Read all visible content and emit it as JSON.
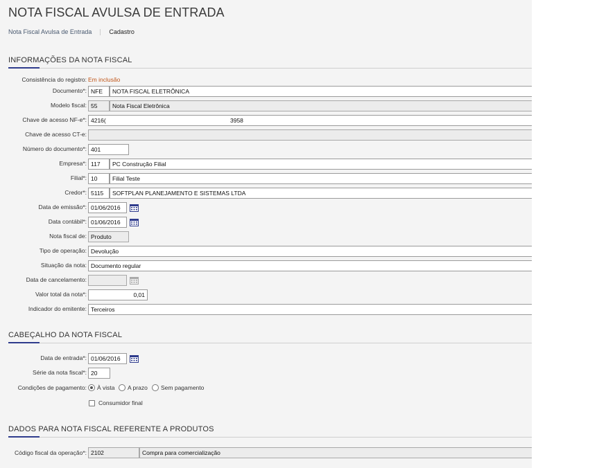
{
  "page": {
    "title": "NOTA FISCAL AVULSA DE ENTRADA",
    "breadcrumb": [
      "Nota Fiscal Avulsa de Entrada",
      "Cadastro"
    ]
  },
  "sections": {
    "info": "INFORMAÇÕES DA NOTA FISCAL",
    "header": "CABEÇALHO DA NOTA FISCAL",
    "products": "DADOS PARA NOTA FISCAL REFERENTE A PRODUTOS"
  },
  "info": {
    "consistencia": {
      "label": "Consistência do registro:",
      "value": "Em inclusão"
    },
    "documento": {
      "label": "Documento*:",
      "code": "NFE",
      "desc": "NOTA FISCAL ELETRÔNICA"
    },
    "modelo": {
      "label": "Modelo fiscal:",
      "code": "55",
      "desc": "Nota Fiscal Eletrônica"
    },
    "chave_nfe": {
      "label": "Chave de acesso NF-e*:",
      "part1": "4216(",
      "part2": "3958"
    },
    "chave_cte": {
      "label": "Chave de acesso CT-e:",
      "value": ""
    },
    "numero": {
      "label": "Número do documento*:",
      "value": "401"
    },
    "empresa": {
      "label": "Empresa*:",
      "code": "117",
      "desc": "PC Construção Filial"
    },
    "filial": {
      "label": "Filial*:",
      "code": "10",
      "desc": "Filial Teste"
    },
    "credor": {
      "label": "Credor*:",
      "code": "5115",
      "desc": "SOFTPLAN PLANEJAMENTO E SISTEMAS LTDA"
    },
    "data_emissao": {
      "label": "Data de emissão*:",
      "value": "01/06/2016"
    },
    "data_contabil": {
      "label": "Data contábil*:",
      "value": "01/06/2016"
    },
    "nota_de": {
      "label": "Nota fiscal de:",
      "value": "Produto"
    },
    "tipo_operacao": {
      "label": "Tipo de operação:",
      "value": "Devolução"
    },
    "situacao": {
      "label": "Situação da nota:",
      "value": "Documento regular"
    },
    "data_cancel": {
      "label": "Data de cancelamento:",
      "value": ""
    },
    "valor_total": {
      "label": "Valor total da nota*:",
      "value": "0,01"
    },
    "indicador": {
      "label": "Indicador do emitente:",
      "value": "Terceiros"
    }
  },
  "header": {
    "data_entrada": {
      "label": "Data de entrada*:",
      "value": "01/06/2016"
    },
    "serie": {
      "label": "Série da nota fiscal*:",
      "value": "20"
    },
    "condicoes": {
      "label": "Condições de pagamento:",
      "options": [
        "À vista",
        "A prazo",
        "Sem pagamento"
      ],
      "selected": "À vista"
    },
    "consumidor_final": {
      "label": "Consumidor final",
      "checked": false
    }
  },
  "products": {
    "cfop": {
      "label": "Código fiscal da operação*:",
      "code": "2102",
      "desc": "Compra para comercialização"
    }
  },
  "icons": {
    "calendar": "calendar-icon"
  },
  "colors": {
    "accent": "#2e3b8c",
    "status": "#c0561a"
  }
}
